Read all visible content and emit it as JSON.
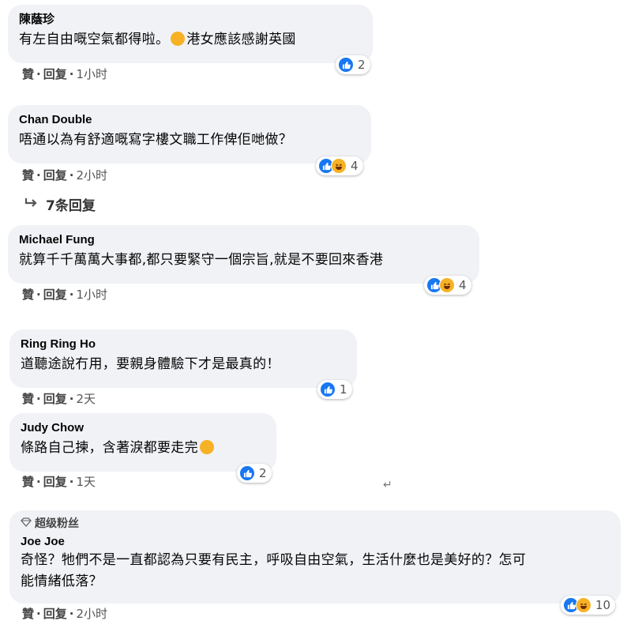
{
  "comments": [
    {
      "author": "陳蔭珍",
      "text": "有左自由嘅空氣都得啦。",
      "text_after_emoji": "港女應該感謝英國",
      "like": "贊",
      "reply": "回复",
      "time": "1小时",
      "reaction_count": "2"
    },
    {
      "author": "Chan Double",
      "text": "唔通以為有舒適嘅寫字樓文職工作俾佢哋做？",
      "like": "贊",
      "reply": "回复",
      "time": "2小时",
      "reaction_count": "4"
    },
    {
      "author": "Michael Fung",
      "text": "就算千千萬萬大事都,都只要緊守一個宗旨,就是不要回來香港",
      "like": "贊",
      "reply": "回复",
      "time": "1小时",
      "reaction_count": "4"
    },
    {
      "author": "Ring Ring Ho",
      "text": "道聽途說冇用，要親身體驗下才是最真的！",
      "like": "贊",
      "reply": "回复",
      "time": "2天",
      "reaction_count": "1"
    },
    {
      "author": "Judy Chow",
      "text": "條路自己揀，含著淚都要走完",
      "like": "贊",
      "reply": "回复",
      "time": "1天",
      "reaction_count": "2"
    },
    {
      "badge": "超级粉丝",
      "author": "Joe Joe",
      "text_line1": "奇怪？牠們不是一直都認為只要有民主，呼吸自由空氣，生活什麼也是美好的？怎可",
      "text_line2": "能情緒低落？",
      "like": "贊",
      "reply": "回复",
      "time": "2小时",
      "reaction_count": "10"
    }
  ],
  "more_replies": "7条回复",
  "reply_arrow_glyph": "↵",
  "colors": {
    "bubble": "#f0f2f5",
    "like_blue": "#1877f2",
    "haha_yellow": "#f7b125"
  },
  "icons": {
    "like": "thumbs-up-icon",
    "haha": "laughing-face-icon",
    "reply_arrow": "reply-arrow-icon",
    "badge": "diamond-icon"
  }
}
